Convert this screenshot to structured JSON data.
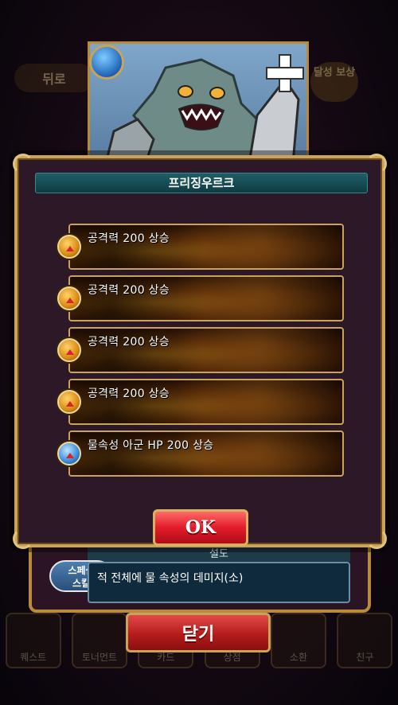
{
  "background": {
    "back_label": "뒤로",
    "reward_label": "달성\n보상",
    "nav": [
      "퀘스트",
      "토너먼트",
      "카드",
      "상점",
      "소환",
      "친구"
    ]
  },
  "under_panel": {
    "desc_title": "설도",
    "special_skill_label": "스페셜\n스킬",
    "special_skill_desc": "적 전체에 물 속성의 데미지(소)",
    "close_label": "닫기"
  },
  "popup": {
    "title": "프리징우르크",
    "effects": [
      {
        "text": "공격력 200 상승",
        "icon": "attack-up-icon"
      },
      {
        "text": "공격력 200 상승",
        "icon": "attack-up-icon"
      },
      {
        "text": "공격력 200 상승",
        "icon": "attack-up-icon"
      },
      {
        "text": "공격력 200 상승",
        "icon": "attack-up-icon"
      },
      {
        "text": "물속성 아군 HP 200 상승",
        "icon": "water-hp-up-icon"
      }
    ],
    "ok_label": "OK"
  },
  "colors": {
    "gold_frame": "#c9a35a",
    "popup_bg": "#2d1827",
    "title_bar": "#1f5e66",
    "button_red": "#e21d2a"
  }
}
